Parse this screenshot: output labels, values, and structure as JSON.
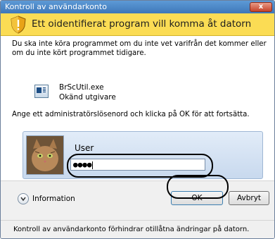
{
  "window": {
    "title": "Kontroll av användarkonto",
    "close_glyph": "x"
  },
  "banner": {
    "icon": "shield-warning-icon",
    "text": "Ett oidentifierat program vill komma åt datorn",
    "color": "#fbdc54"
  },
  "body": {
    "description": "Du ska inte köra programmet om du inte vet varifrån det kommer eller om du inte kört programmet tidigare.",
    "program": {
      "icon": "program-icon",
      "name": "BrScUtil.exe",
      "publisher": "Okänd utgivare"
    },
    "instruction": "Ange ett administratörslösenord och klicka på OK för att fortsätta."
  },
  "credentials": {
    "avatar": "cat-avatar",
    "username": "User",
    "password_mask": "●●●●"
  },
  "footer": {
    "toggle_icon": "chevron-down-icon",
    "info_label": "Information",
    "ok_label": "OK",
    "cancel_label": "Avbryt",
    "status_text": "Kontroll av användarkonto förhindrar otillåtna ändringar på datorn."
  }
}
